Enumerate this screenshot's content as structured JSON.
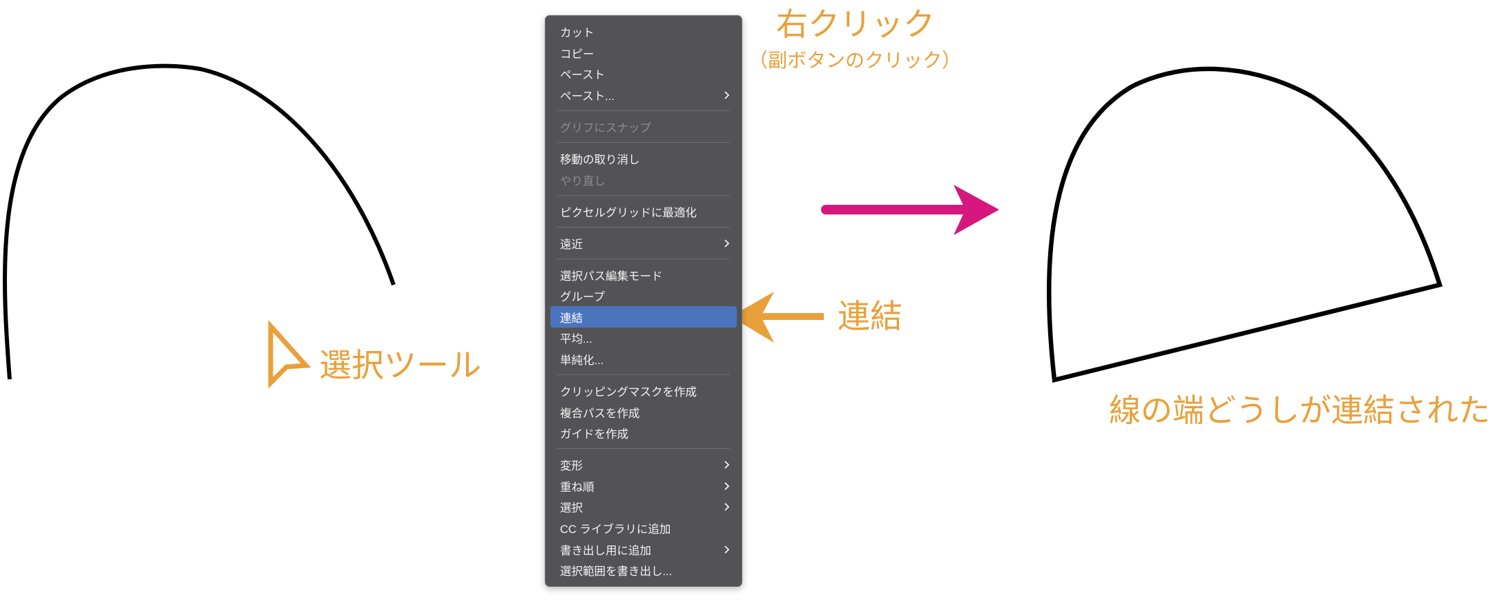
{
  "annotations": {
    "right_click_title": "右クリック",
    "right_click_subtitle": "（副ボタンのクリック）",
    "join_label": "連結",
    "selection_tool_label": "選択ツール",
    "result_label": "線の端どうしが連結された"
  },
  "context_menu": {
    "items": [
      {
        "label": "カット",
        "enabled": true
      },
      {
        "label": "コピー",
        "enabled": true
      },
      {
        "label": "ペースト",
        "enabled": true
      },
      {
        "label": "ペースト...",
        "enabled": true,
        "submenu": true
      },
      {
        "label": "グリフにスナップ",
        "enabled": false
      },
      {
        "label": "移動の取り消し",
        "enabled": true
      },
      {
        "label": "やり直し",
        "enabled": false
      },
      {
        "label": "ピクセルグリッドに最適化",
        "enabled": true
      },
      {
        "label": "遠近",
        "enabled": true,
        "submenu": true
      },
      {
        "label": "選択パス編集モード",
        "enabled": true
      },
      {
        "label": "グループ",
        "enabled": true
      },
      {
        "label": "連結",
        "enabled": true,
        "highlighted": true
      },
      {
        "label": "平均...",
        "enabled": true
      },
      {
        "label": "単純化...",
        "enabled": true
      },
      {
        "label": "クリッピングマスクを作成",
        "enabled": true
      },
      {
        "label": "複合パスを作成",
        "enabled": true
      },
      {
        "label": "ガイドを作成",
        "enabled": true
      },
      {
        "label": "変形",
        "enabled": true,
        "submenu": true
      },
      {
        "label": "重ね順",
        "enabled": true,
        "submenu": true
      },
      {
        "label": "選択",
        "enabled": true,
        "submenu": true
      },
      {
        "label": "CC ライブラリに追加",
        "enabled": true
      },
      {
        "label": "書き出し用に追加",
        "enabled": true,
        "submenu": true
      },
      {
        "label": "選択範囲を書き出し...",
        "enabled": true
      }
    ],
    "submenu_icon": "chevron-right-icon"
  },
  "icons": {
    "selection_tool": "selection-tool-arrow-icon",
    "join_pointer": "arrow-left-icon",
    "result_pointer": "arrow-right-icon"
  },
  "colors": {
    "annotation_orange": "#E9A03A",
    "result_arrow_magenta": "#D5177E",
    "menu_background": "#535355",
    "menu_highlight": "#4A74BE",
    "path_stroke": "#000000"
  }
}
